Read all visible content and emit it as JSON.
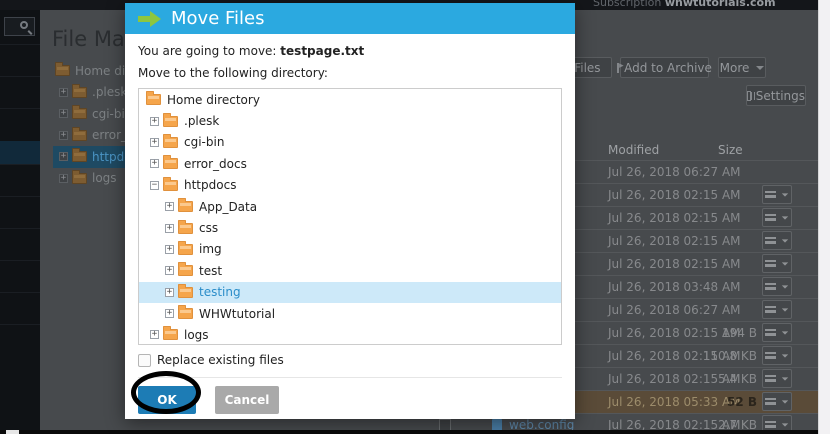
{
  "topbar": {
    "subscription_label": "Subscription",
    "domain": "whwtutorials.com"
  },
  "page": {
    "title": "File Manager"
  },
  "bg_tree": {
    "items": [
      {
        "label": "Home directory",
        "level": 0,
        "exp": ""
      },
      {
        "label": ".plesk",
        "level": 1,
        "exp": "+"
      },
      {
        "label": "cgi-bin",
        "level": 1,
        "exp": "+"
      },
      {
        "label": "error_docs",
        "level": 1,
        "exp": "+"
      },
      {
        "label": "httpdocs",
        "level": 1,
        "exp": "+",
        "selected": true
      },
      {
        "label": "logs",
        "level": 1,
        "exp": "+"
      }
    ]
  },
  "toolbar": {
    "extract": "Extract Files",
    "archive": "Add to Archive",
    "more": "More",
    "settings": "Settings"
  },
  "table": {
    "headers": [
      "Modified",
      "Size"
    ],
    "rows": [
      {
        "date": "Jul 26, 2018 06:27 AM",
        "size": "",
        "menu": false
      },
      {
        "date": "Jul 26, 2018 02:15 AM",
        "size": "",
        "menu": true
      },
      {
        "date": "Jul 26, 2018 02:15 AM",
        "size": "",
        "menu": true
      },
      {
        "date": "Jul 26, 2018 02:15 AM",
        "size": "",
        "menu": true
      },
      {
        "date": "Jul 26, 2018 02:15 AM",
        "size": "",
        "menu": true
      },
      {
        "date": "Jul 26, 2018 03:48 AM",
        "size": "",
        "menu": true
      },
      {
        "date": "Jul 26, 2018 06:27 AM",
        "size": "",
        "menu": true
      },
      {
        "date": "Jul 26, 2018 02:15 AM",
        "size": "194 B",
        "menu": true
      },
      {
        "date": "Jul 26, 2018 02:15 AM",
        "size": "110.8 KB",
        "menu": true
      },
      {
        "date": "Jul 26, 2018 02:15 AM",
        "size": "5.4 KB",
        "menu": true
      },
      {
        "date": "Jul 26, 2018 05:33 AM",
        "size": "52 B",
        "menu": true,
        "highlighted": true
      },
      {
        "date": "Jul 26, 2018 02:15 AM",
        "size": "2.7 KB",
        "menu": true,
        "name": "web.config"
      }
    ]
  },
  "modal": {
    "title": "Move Files",
    "intro_label": "You are going to move: ",
    "file_name": "testpage.txt",
    "directory_label": "Move to the following directory:",
    "tree": [
      {
        "label": "Home directory",
        "level": 0,
        "exp": ""
      },
      {
        "label": ".plesk",
        "level": 1,
        "exp": "+"
      },
      {
        "label": "cgi-bin",
        "level": 1,
        "exp": "+"
      },
      {
        "label": "error_docs",
        "level": 1,
        "exp": "+"
      },
      {
        "label": "httpdocs",
        "level": 1,
        "exp": "−"
      },
      {
        "label": "App_Data",
        "level": 2,
        "exp": "+"
      },
      {
        "label": "css",
        "level": 2,
        "exp": "+"
      },
      {
        "label": "img",
        "level": 2,
        "exp": "+"
      },
      {
        "label": "test",
        "level": 2,
        "exp": "+"
      },
      {
        "label": "testing",
        "level": 2,
        "exp": "+",
        "selected": true
      },
      {
        "label": "WHWtutorial",
        "level": 2,
        "exp": "+"
      },
      {
        "label": "logs",
        "level": 1,
        "exp": "+"
      }
    ],
    "replace_label": "Replace existing files",
    "ok_label": "OK",
    "cancel_label": "Cancel"
  },
  "icons": {
    "modal_header": "green-arrow-right-icon",
    "search": "search-icon",
    "settings": "grid-icon",
    "archive": "archive-box-icon",
    "row_menu": "hamburger-caret-icon"
  },
  "colors": {
    "modal_header_blue": "#2BA9E0",
    "arrow_green": "#8DC63F",
    "ok_button_blue": "#1D7CB5",
    "cancel_gray": "#A9A9A9",
    "folder_orange": "#F5A54B",
    "tree_selection_blue": "#CDE9F9",
    "selected_file_row_tan": "#5A4B38",
    "file_link_blue": "#5F89AB"
  }
}
